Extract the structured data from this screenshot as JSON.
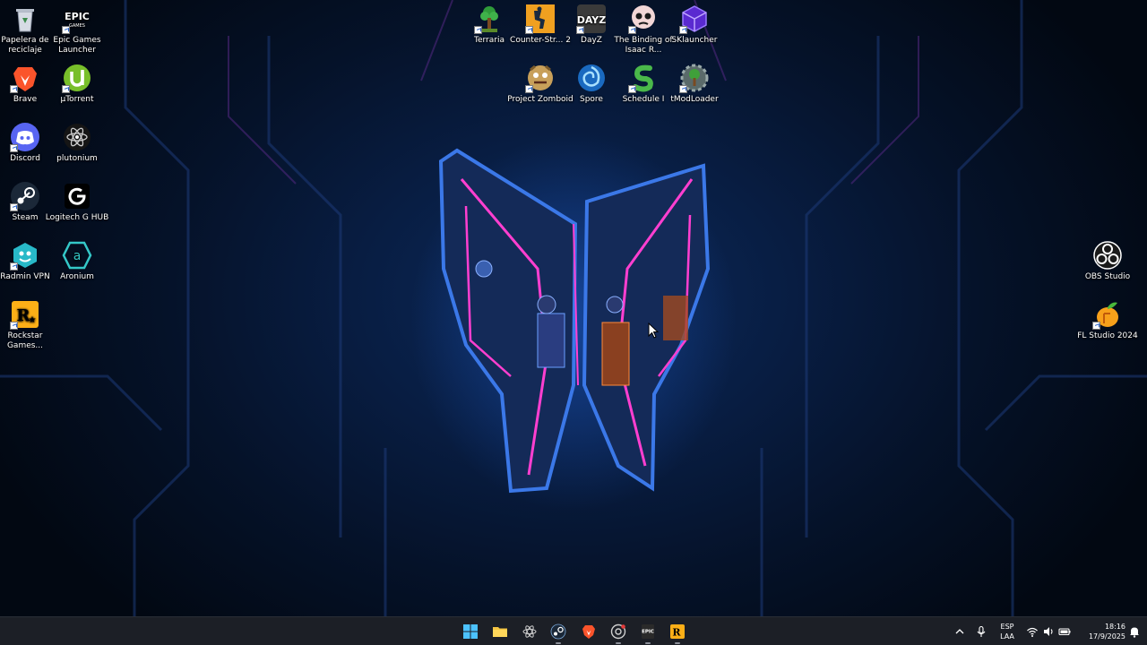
{
  "desktop": {
    "icons_left": [
      {
        "label": "Papelera de reciclaje",
        "icon": "recycle-bin-icon"
      },
      {
        "label": "Epic Games Launcher",
        "icon": "epic-games-icon"
      },
      {
        "label": "Brave",
        "icon": "brave-icon"
      },
      {
        "label": "µTorrent",
        "icon": "utorrent-icon"
      },
      {
        "label": "Discord",
        "icon": "discord-icon"
      },
      {
        "label": "plutonium",
        "icon": "plutonium-icon"
      },
      {
        "label": "Steam",
        "icon": "steam-icon"
      },
      {
        "label": "Logitech G HUB",
        "icon": "logitech-ghub-icon"
      },
      {
        "label": "Radmin VPN",
        "icon": "radmin-vpn-icon"
      },
      {
        "label": "Aronium",
        "icon": "aronium-icon"
      },
      {
        "label": "Rockstar Games...",
        "icon": "rockstar-games-icon"
      }
    ],
    "icons_top": [
      {
        "label": "Terraria",
        "icon": "terraria-icon"
      },
      {
        "label": "Counter-Str... 2",
        "icon": "counter-strike-icon"
      },
      {
        "label": "DayZ",
        "icon": "dayz-icon"
      },
      {
        "label": "The Binding of Isaac R...",
        "icon": "binding-of-isaac-icon"
      },
      {
        "label": "SKlauncher",
        "icon": "sklauncher-icon"
      },
      {
        "label": "Project Zomboid",
        "icon": "project-zomboid-icon"
      },
      {
        "label": "Spore",
        "icon": "spore-icon"
      },
      {
        "label": "Schedule I",
        "icon": "schedule-i-icon"
      },
      {
        "label": "tModLoader",
        "icon": "tmodloader-icon"
      }
    ],
    "icons_right": [
      {
        "label": "OBS Studio",
        "icon": "obs-studio-icon"
      },
      {
        "label": "FL Studio 2024",
        "icon": "fl-studio-icon"
      }
    ]
  },
  "taskbar": {
    "apps": [
      "windows-start-icon",
      "file-explorer-icon",
      "plutonium-icon",
      "steam-icon",
      "brave-icon",
      "chrome-icon",
      "epic-games-icon",
      "rockstar-games-icon"
    ],
    "tray": {
      "language_line1": "ESP",
      "language_line2": "LAA",
      "time": "18:16",
      "date": "17/9/2025"
    }
  },
  "colors": {
    "taskbar_bg": "#1c1f26",
    "desktop_bg": "#081d42",
    "neon_pink": "#ff3fd0",
    "neon_blue": "#2f7cff"
  }
}
